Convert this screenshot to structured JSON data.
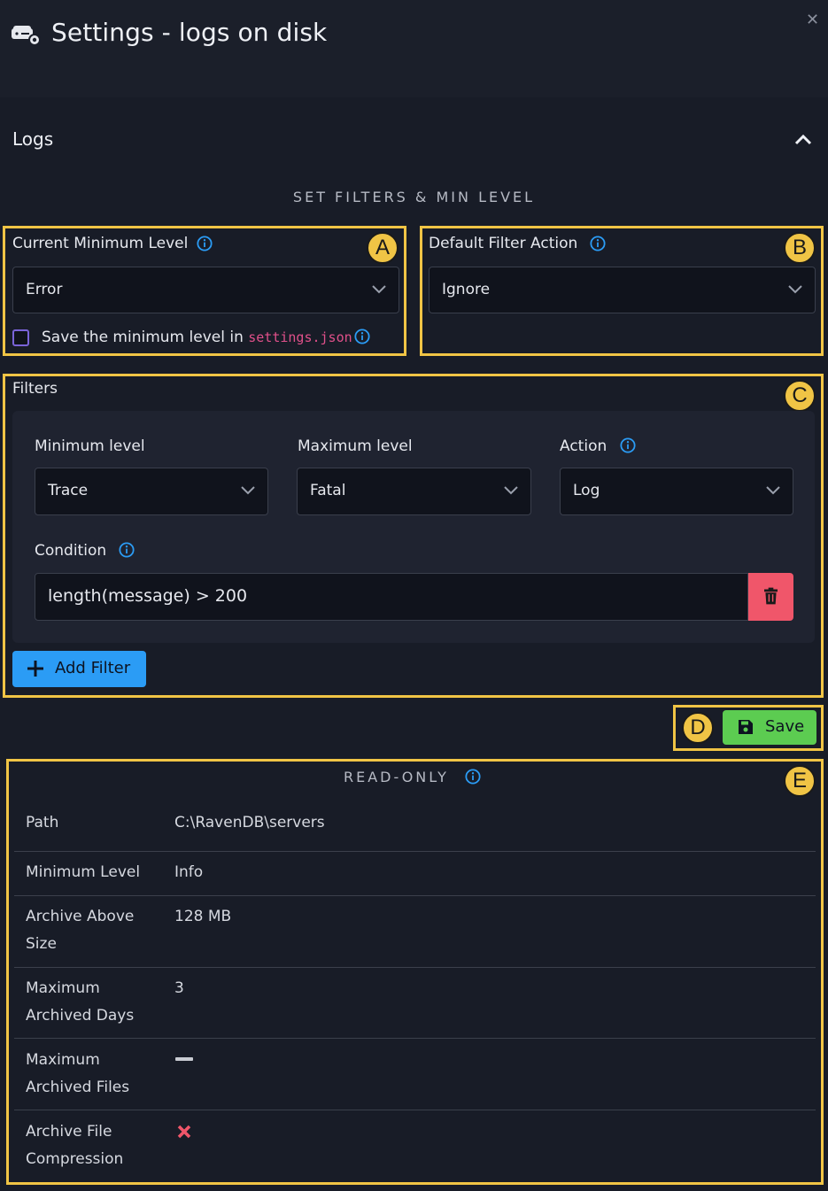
{
  "window": {
    "title": "Settings - logs on disk",
    "icon": "logs-settings-icon",
    "close_icon": "close-icon"
  },
  "section": {
    "title": "Logs",
    "collapse_icon": "chevron-up-icon"
  },
  "filters_heading": "SET FILTERS & MIN LEVEL",
  "callouts": [
    "A",
    "B",
    "C",
    "D",
    "E"
  ],
  "current_min_level": {
    "label": "Current Minimum Level",
    "value": "Error",
    "save_checkbox_prefix": "Save the minimum level in",
    "save_checkbox_file": "settings.json",
    "checked": false
  },
  "default_filter_action": {
    "label": "Default Filter Action",
    "value": "Ignore"
  },
  "filters": {
    "label": "Filters",
    "items": [
      {
        "min_label": "Minimum level",
        "min_value": "Trace",
        "max_label": "Maximum level",
        "max_value": "Fatal",
        "action_label": "Action",
        "action_value": "Log",
        "condition_label": "Condition",
        "condition_value": "length(message) > 200"
      }
    ],
    "add_button": "Add Filter"
  },
  "save_button": "Save",
  "read_only": {
    "heading": "READ-ONLY",
    "rows": [
      {
        "label": "Path",
        "value": "C:\\RavenDB\\servers"
      },
      {
        "label": "Minimum Level",
        "value": "Info"
      },
      {
        "label": "Archive Above Size",
        "value": "128 MB"
      },
      {
        "label": "Maximum Archived Days",
        "value": "3"
      },
      {
        "label": "Maximum Archived Files",
        "value": "",
        "icon": "dash-icon"
      },
      {
        "label": "Archive File Compression",
        "value": "",
        "icon": "cross-icon"
      }
    ]
  },
  "colors": {
    "accent_yellow": "#f0c445",
    "info_blue": "#2b9cf5",
    "danger": "#f0566a",
    "success": "#5ccc51",
    "code_pink": "#e0508a"
  }
}
